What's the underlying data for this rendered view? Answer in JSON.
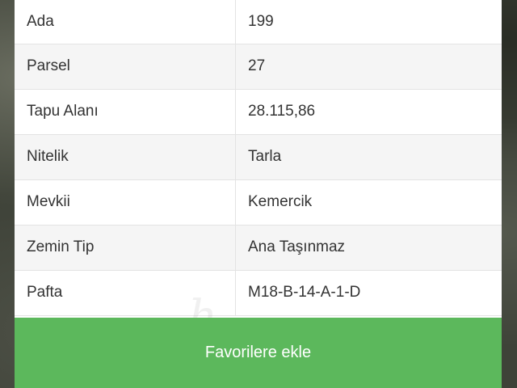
{
  "details": {
    "rows": [
      {
        "label": "Ada",
        "value": "199"
      },
      {
        "label": "Parsel",
        "value": "27"
      },
      {
        "label": "Tapu Alanı",
        "value": "28.115,86"
      },
      {
        "label": "Nitelik",
        "value": "Tarla"
      },
      {
        "label": "Mevkii",
        "value": "Kemercik"
      },
      {
        "label": "Zemin Tip",
        "value": "Ana Taşınmaz"
      },
      {
        "label": "Pafta",
        "value": "M18-B-14-A-1-D"
      }
    ]
  },
  "actions": {
    "favorite_label": "Favorilere ekle"
  },
  "colors": {
    "button": "#5cb85c",
    "row_alt": "#f5f5f5",
    "text": "#333333"
  }
}
